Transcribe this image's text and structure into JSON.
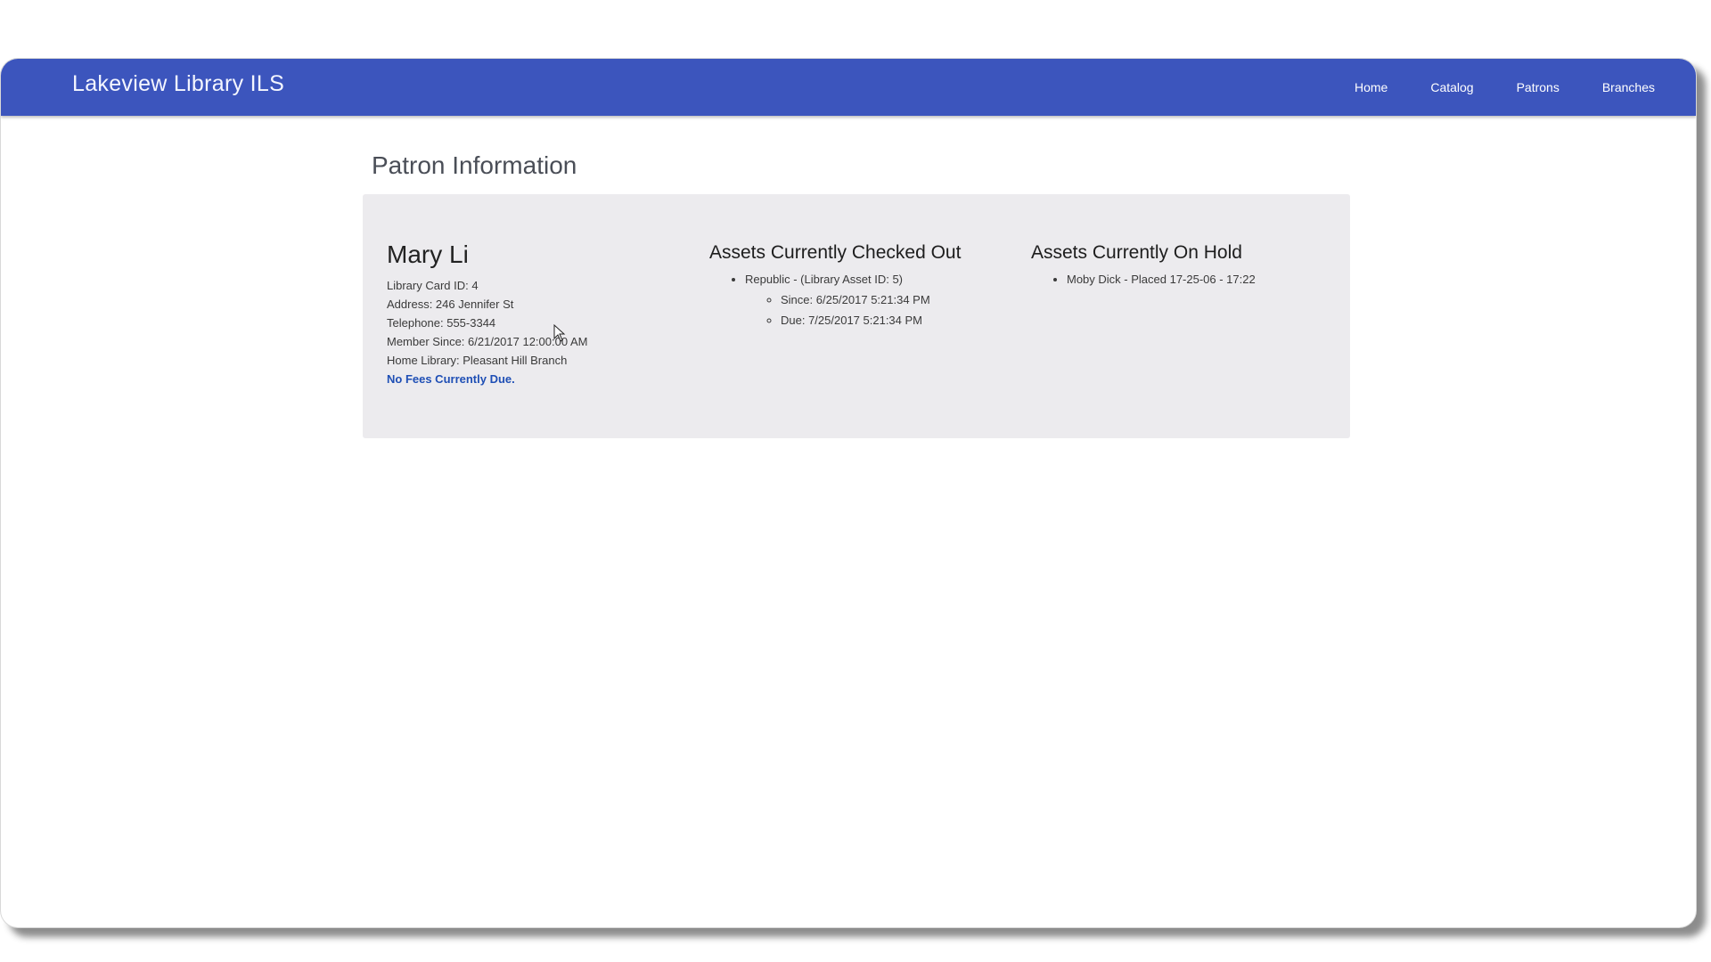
{
  "app": {
    "brand": "Lakeview Library ILS"
  },
  "nav": {
    "items": [
      {
        "label": "Home"
      },
      {
        "label": "Catalog"
      },
      {
        "label": "Patrons"
      },
      {
        "label": "Branches"
      }
    ]
  },
  "page": {
    "title": "Patron Information"
  },
  "patron": {
    "name": "Mary Li",
    "card_id": "Library Card ID: 4",
    "address": "Address: 246 Jennifer St",
    "telephone": "Telephone: 555-3344",
    "member_since": "Member Since: 6/21/2017 12:00:00 AM",
    "home_library": "Home Library: Pleasant Hill Branch",
    "fees": "No Fees Currently Due."
  },
  "checked_out": {
    "heading": "Assets Currently Checked Out",
    "items": [
      {
        "title": "Republic - (Library Asset ID: 5)",
        "since": "Since: 6/25/2017 5:21:34 PM",
        "due": "Due: 7/25/2017 5:21:34 PM"
      }
    ]
  },
  "on_hold": {
    "heading": "Assets Currently On Hold",
    "items": [
      {
        "label": "Moby Dick - Placed 17-25-06 - 17:22"
      }
    ]
  },
  "colors": {
    "navbar": "#3c55bd",
    "panel": "#ecebee",
    "fees_link": "#1f4fb5"
  }
}
